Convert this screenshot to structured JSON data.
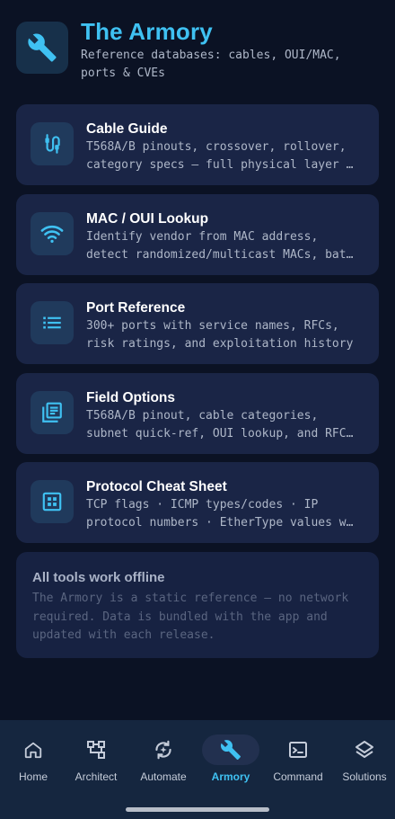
{
  "header": {
    "icon": "wrench-icon",
    "title": "The Armory",
    "subtitle": "Reference databases: cables, OUI/MAC, ports & CVEs"
  },
  "tools": [
    {
      "icon": "cable-icon",
      "title": "Cable Guide",
      "desc_line1": "T568A/B pinouts, crossover, rollover,",
      "desc_line2": "category specs — full physical layer …"
    },
    {
      "icon": "wifi-icon",
      "title": "MAC / OUI Lookup",
      "desc_line1": "Identify vendor from MAC address,",
      "desc_line2": "detect randomized/multicast MACs, bat…"
    },
    {
      "icon": "list-icon",
      "title": "Port Reference",
      "desc_line1": "300+ ports with service names, RFCs,",
      "desc_line2": "risk ratings, and exploitation history"
    },
    {
      "icon": "library-books-icon",
      "title": "Field Options",
      "desc_line1": "T568A/B pinout, cable categories,",
      "desc_line2": "subnet quick-ref, OUI lookup, and RFC…"
    },
    {
      "icon": "grid-table-icon",
      "title": "Protocol Cheat Sheet",
      "desc_line1": "TCP flags · ICMP types/codes · IP",
      "desc_line2": "protocol numbers · EtherType values w…"
    }
  ],
  "offline": {
    "title": "All tools work offline",
    "text": "The Armory is a static reference — no network required. Data is bundled with the app and updated with each release."
  },
  "nav": {
    "items": [
      {
        "label": "Home",
        "icon": "home-icon"
      },
      {
        "label": "Architect",
        "icon": "architect-icon"
      },
      {
        "label": "Automate",
        "icon": "automate-icon"
      },
      {
        "label": "Armory",
        "icon": "wrench-icon"
      },
      {
        "label": "Command",
        "icon": "terminal-icon"
      },
      {
        "label": "Solutions",
        "icon": "layers-icon"
      }
    ],
    "active": "Armory"
  },
  "colors": {
    "background": "#0b1224",
    "card": "#1a2546",
    "accent": "#3fc1f2",
    "nav_background": "#15263f"
  }
}
